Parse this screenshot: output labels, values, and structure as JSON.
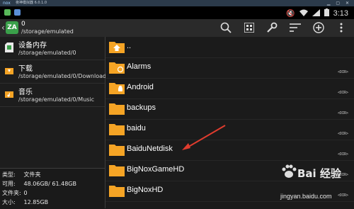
{
  "emulator": {
    "logo": "nox",
    "title": "夜神模拟器 6.0.1.0"
  },
  "status_bar": {
    "time": "3:13"
  },
  "toolbar": {
    "count": "0",
    "path": "/storage/emulated",
    "app_icon_label": "ZA"
  },
  "locations": [
    {
      "name": "设备内存",
      "path": "/storage/emulated/0"
    },
    {
      "name": "下载",
      "path": "/storage/emulated/0/Download"
    },
    {
      "name": "音乐",
      "path": "/storage/emulated/0/Music"
    }
  ],
  "info": {
    "type_label": "类型:",
    "type_value": "文件夹",
    "avail_label": "可用:",
    "avail_value": "48.06GB/ 61.48GB",
    "folders_label": "文件夹:",
    "folders_value": "0",
    "size_label": "大小:",
    "size_value": "12.85GB"
  },
  "files": [
    {
      "name": "..",
      "tag": ""
    },
    {
      "name": "Alarms",
      "tag": "<DIR>"
    },
    {
      "name": "Android",
      "tag": "<DIR>"
    },
    {
      "name": "backups",
      "tag": "<DIR>"
    },
    {
      "name": "baidu",
      "tag": "<DIR>"
    },
    {
      "name": "BaiduNetdisk",
      "tag": "<DIR>"
    },
    {
      "name": "BigNoxGameHD",
      "tag": "<DIR>"
    },
    {
      "name": "BigNoxHD",
      "tag": "<DIR>"
    }
  ],
  "watermark": {
    "title": "Bai 经验",
    "url": "jingyan.baidu.com"
  },
  "colors": {
    "folder": "#f5a425",
    "toolbar_bg": "#2a2a2a",
    "arrow": "#e03c2e",
    "app_icon": "#3aa04a"
  }
}
